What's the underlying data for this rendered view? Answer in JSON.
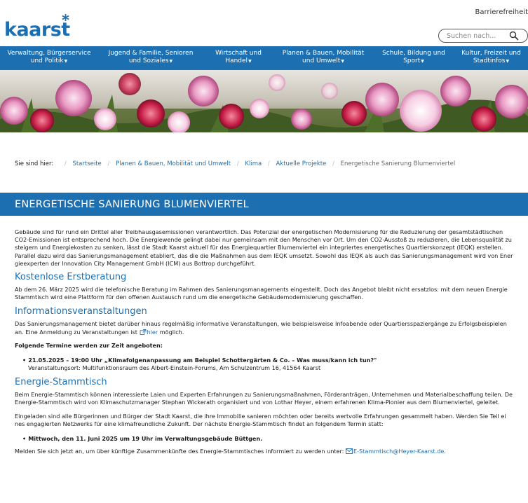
{
  "topbar": {
    "accessibility_label": "Barrierefreiheit"
  },
  "header": {
    "logo_text": "kaarst",
    "logo_star": "*"
  },
  "search": {
    "placeholder": "Suchen nach..."
  },
  "nav": {
    "items": [
      {
        "line1": "Verwaltung, Bürgerservice",
        "line2": "und Politik"
      },
      {
        "line1": "Jugend & Familie, Senioren",
        "line2": "und Soziales"
      },
      {
        "line1": "Wirtschaft und",
        "line2": "Handel"
      },
      {
        "line1": "Planen & Bauen, Mobilität",
        "line2": "und Umwelt"
      },
      {
        "line1": "Schule, Bildung und",
        "line2": "Sport"
      },
      {
        "line1": "Kultur, Freizeit und",
        "line2": "Stadtinfos"
      }
    ]
  },
  "breadcrumb": {
    "lead": "Sie sind hier:",
    "links": [
      "Startseite",
      "Planen & Bauen, Mobilität und Umwelt",
      "Klima",
      "Aktuelle Projekte"
    ],
    "current": "Energetische Sanierung Blumenviertel"
  },
  "page": {
    "title": "ENERGETISCHE SANIERUNG BLUMENVIERTEL"
  },
  "intro": {
    "lines": [
      "Gebäude sind für rund ein Drittel aller Treibhausgasemissionen verantwortlich. Das Potenzial der energetischen Modernisierung für die Reduzierung der gesamtstädtischen",
      "CO2-Emissionen ist entsprechend hoch. Die Energiewende gelingt dabei nur gemeinsam mit den Menschen vor Ort. Um den CO2-Ausstoß zu reduzieren, die Lebensqualität zu",
      "steigern und Energiekosten zu senken, lässt die Stadt Kaarst aktuell für das Energiequartier Blumenviertel ein integriertes energetisches Quartierskonzept (IEQK) erstellen.",
      "Parallel dazu wird das Sanierungsmanagement etabliert, das die die Maßnahmen aus dem IEQK umsetzt. Sowohl das IEQK als auch das Sanierungsmanagement wird von Ener",
      "gieexperten der Innovation City Management GmbH (ICM) aus Bottrop durchgeführt."
    ]
  },
  "section1": {
    "heading": "Kostenlose Erstberatung",
    "lines": [
      "Ab dem 26. März 2025 wird die telefonische Beratung im Rahmen des Sanierungsmanagements eingestellt. Doch das Angebot bleibt nicht ersatzlos: mit dem neuen Energie",
      "Stammtisch wird eine Plattform für den offenen Austausch rund um die energetische Gebäudemodernisierung geschaffen."
    ]
  },
  "section2": {
    "heading": "Informationsveranstaltungen",
    "line1": "Das Sanierungsmanagement bietet darüber hinaus regelmäßig informative Veranstaltungen, wie beispielsweise Infoabende oder Quartiersspaziergänge zu Erfolgsbeispielen",
    "line2_pre": "an. Eine Anmeldung zu Veranstaltungen ist",
    "link": "hier",
    "line2_post": "möglich.",
    "dates_heading": "Folgende Termine werden zur Zeit angeboten:",
    "event_title": "21.05.2025 – 19:00 Uhr „Klimafolgenanpassung am Beispiel Schottergärten & Co. – Was muss/kann ich tun?\"",
    "event_location": "Veranstaltungsort: Multifunktionsraum des Albert-Einstein-Forums, Am Schulzentrum 16, 41564 Kaarst"
  },
  "section3": {
    "heading": "Energie-Stammtisch",
    "para1": [
      "Beim Energie-Stammtisch können interessierte Laien und Experten Erfahrungen zu Sanierungsmaßnahmen, Förderanträgen, Unternehmen und Materialbeschaffung teilen. De",
      "Energie-Stammtisch wird von Klimaschutzmanager Stephan Wickerath organisiert und von Lothar Heyer, einem erfahrenen Klima-Pionier aus dem Blumenviertel, geleitet."
    ],
    "para2": [
      "Eingeladen sind alle Bürgerinnen und Bürger der Stadt Kaarst, die ihre Immobilie sanieren möchten oder bereits wertvolle Erfahrungen gesammelt haben. Werden Sie Teil ei",
      "nes engagierten Netzwerks für eine klimafreundliche Zukunft. Der nächste Energie-Stammtisch findet an folgendem Termin statt:"
    ],
    "next_date": "Mittwoch, den 11. Juni 2025 um 19 Uhr im Verwaltungsgebäude Büttgen.",
    "signup_pre": "Melden Sie sich jetzt an, um über künftige Zusammenkünfte des Energie-Stammtisches informiert zu werden unter:",
    "email": "E-Stammtisch@Heyer-Kaarst.de",
    "signup_post": "."
  },
  "colors": {
    "brand_blue": "#1c6fb0",
    "text": "#1a1a1a"
  },
  "icons": [
    "search-icon",
    "chevron-down-icon",
    "external-link-icon",
    "mail-icon"
  ]
}
